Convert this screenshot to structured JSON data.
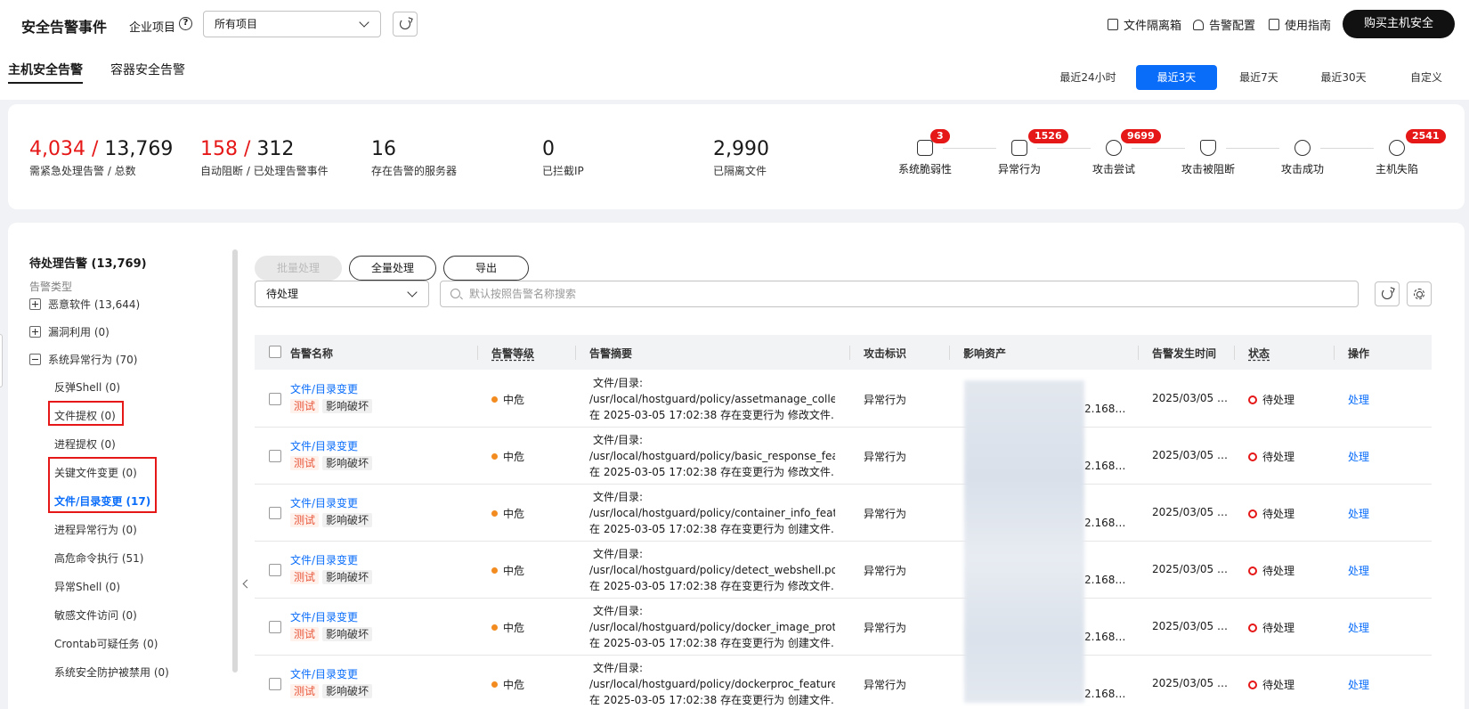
{
  "header": {
    "title": "安全告警事件",
    "project_label": "企业项目",
    "project_select": "所有项目",
    "links": [
      "文件隔离箱",
      "告警配置",
      "使用指南"
    ],
    "buy_button": "购买主机安全"
  },
  "tabs": [
    "主机安全告警",
    "容器安全告警"
  ],
  "time_options": [
    "最近24小时",
    "最近3天",
    "最近7天",
    "最近30天",
    "自定义"
  ],
  "stats": [
    {
      "num_red": "4,034 / ",
      "num": "13,769",
      "label": "需紧急处理告警  / 总数"
    },
    {
      "num_red": "158 / ",
      "num": "312",
      "label": "自动阻断  / 已处理告警事件"
    },
    {
      "num_red": "",
      "num": "16",
      "label": "存在告警的服务器"
    },
    {
      "num_red": "",
      "num": "0",
      "label": "已拦截IP"
    },
    {
      "num_red": "",
      "num": "2,990",
      "label": "已隔离文件"
    }
  ],
  "chain": [
    {
      "label": "系统脆弱性",
      "badge": "3"
    },
    {
      "label": "异常行为",
      "badge": "1526"
    },
    {
      "label": "攻击尝试",
      "badge": "9699"
    },
    {
      "label": "攻击被阻断",
      "badge": ""
    },
    {
      "label": "攻击成功",
      "badge": ""
    },
    {
      "label": "主机失陷",
      "badge": "2541"
    }
  ],
  "sidebar": {
    "title": "待处理告警  (13,769)",
    "subtitle": "告警类型",
    "groups": [
      {
        "label": "恶意软件   (13,644)"
      },
      {
        "label": "漏洞利用   (0)"
      },
      {
        "label": "系统异常行为   (70)"
      }
    ],
    "items": [
      "反弹Shell   (0)",
      "文件提权   (0)",
      "进程提权   (0)",
      "关键文件变更   (0)",
      "文件/目录变更   (17)",
      "进程异常行为   (0)",
      "高危命令执行   (51)",
      "异常Shell   (0)",
      "敏感文件访问   (0)",
      "Crontab可疑任务   (0)",
      "系统安全防护被禁用   (0)"
    ]
  },
  "toolbar": {
    "batch": "批量处理",
    "all": "全量处理",
    "export": "导出",
    "status_filter": "待处理",
    "search_placeholder": "默认按照告警名称搜索"
  },
  "table": {
    "columns": [
      "告警名称",
      "告警等级",
      "告警摘要",
      "攻击标识",
      "影响资产",
      "告警发生时间",
      "状态",
      "操作"
    ],
    "rows": [
      {
        "name": "文件/目录变更",
        "tag1": "测试",
        "tag2": "影响破坏",
        "level": "中危",
        "s1": "文件/目录:",
        "s2": "/usr/local/hostguard/policy/assetmanage_collect.policy",
        "s3": "在 2025-03-05 17:02:38 存在变更行为 修改文件…",
        "attack": "异常行为",
        "asset": "2.168…",
        "time": "2025/03/05 …",
        "status": "待处理",
        "action": "处理"
      },
      {
        "name": "文件/目录变更",
        "tag1": "测试",
        "tag2": "影响破坏",
        "level": "中危",
        "s1": "文件/目录:",
        "s2": "/usr/local/hostguard/policy/basic_response_feature.policy",
        "s3": "在 2025-03-05 17:02:38 存在变更行为 修改文件…",
        "attack": "异常行为",
        "asset": "2.168…",
        "time": "2025/03/05 …",
        "status": "待处理",
        "action": "处理"
      },
      {
        "name": "文件/目录变更",
        "tag1": "测试",
        "tag2": "影响破坏",
        "level": "中危",
        "s1": "文件/目录:",
        "s2": "/usr/local/hostguard/policy/container_info_feature.policy",
        "s3": "在 2025-03-05 17:02:38 存在变更行为 创建文件…",
        "attack": "异常行为",
        "asset": "2.168…",
        "time": "2025/03/05 …",
        "status": "待处理",
        "action": "处理"
      },
      {
        "name": "文件/目录变更",
        "tag1": "测试",
        "tag2": "影响破坏",
        "level": "中危",
        "s1": "文件/目录:",
        "s2": "/usr/local/hostguard/policy/detect_webshell.policy,",
        "s3": "在 2025-03-05 17:02:38 存在变更行为 修改文件…",
        "attack": "异常行为",
        "asset": "2.168…",
        "time": "2025/03/05 …",
        "status": "待处理",
        "action": "处理"
      },
      {
        "name": "文件/目录变更",
        "tag1": "测试",
        "tag2": "影响破坏",
        "level": "中危",
        "s1": "文件/目录:",
        "s2": "/usr/local/hostguard/policy/docker_image_protect_feature.policy",
        "s3": "在 2025-03-05 17:02:38 存在变更行为 创建文件…",
        "attack": "异常行为",
        "asset": "2.168…",
        "time": "2025/03/05 …",
        "status": "待处理",
        "action": "处理"
      },
      {
        "name": "文件/目录变更",
        "tag1": "测试",
        "tag2": "影响破坏",
        "level": "中危",
        "s1": "文件/目录:",
        "s2": "/usr/local/hostguard/policy/dockerproc_feature.policy",
        "s3": "在 2025-03-05 17:02:38 存在变更行为 创建文件…",
        "attack": "异常行为",
        "asset": "2.168…",
        "time": "2025/03/05 …",
        "status": "待处理",
        "action": "处理"
      }
    ]
  }
}
